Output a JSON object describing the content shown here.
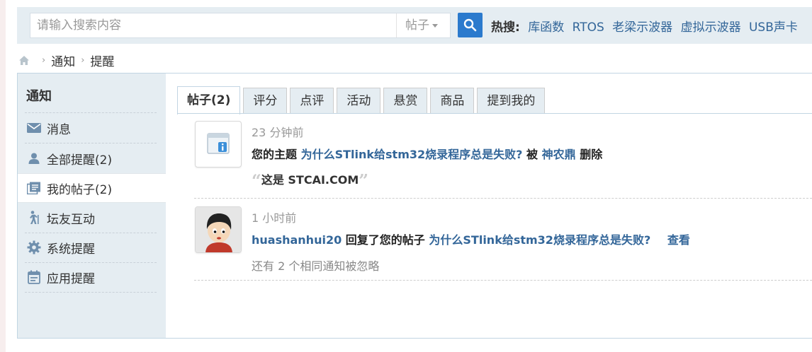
{
  "search": {
    "placeholder": "请输入搜索内容",
    "type_selected": "帖子",
    "hot_label": "热搜:",
    "hot_terms": [
      "库函数",
      "RTOS",
      "老梁示波器",
      "虚拟示波器",
      "USB声卡"
    ]
  },
  "breadcrumb": {
    "items": [
      "通知",
      "提醒"
    ]
  },
  "sidebar": {
    "title": "通知",
    "items": [
      {
        "label": "消息",
        "icon": "envelope-icon"
      },
      {
        "label": "全部提醒(2)",
        "icon": "user-icon"
      },
      {
        "label": "我的帖子(2)",
        "icon": "posts-icon"
      },
      {
        "label": "坛友互动",
        "icon": "walking-person-icon"
      },
      {
        "label": "系统提醒",
        "icon": "gear-icon"
      },
      {
        "label": "应用提醒",
        "icon": "calendar-icon"
      }
    ]
  },
  "tabs": [
    "帖子(2)",
    "评分",
    "点评",
    "活动",
    "悬赏",
    "商品",
    "提到我的"
  ],
  "notices": [
    {
      "time": "23 分钟前",
      "prefix": "您的主题",
      "thread": "为什么STlink给stm32烧录程序总是失败?",
      "mid": "被",
      "user": "神农鼎",
      "action": "删除",
      "quote": "这是 STCAI.COM"
    },
    {
      "time": "1 小时前",
      "user": "huashanhui20",
      "action": "回复了您的帖子",
      "thread": "为什么STlink给stm32烧录程序总是失败?",
      "view": "查看",
      "sub": "还有 2 个相同通知被忽略"
    }
  ],
  "colors": {
    "accent": "#2b7acd",
    "link": "#336699",
    "panel_bg": "#e5edf2",
    "border": "#c2d5e3"
  }
}
